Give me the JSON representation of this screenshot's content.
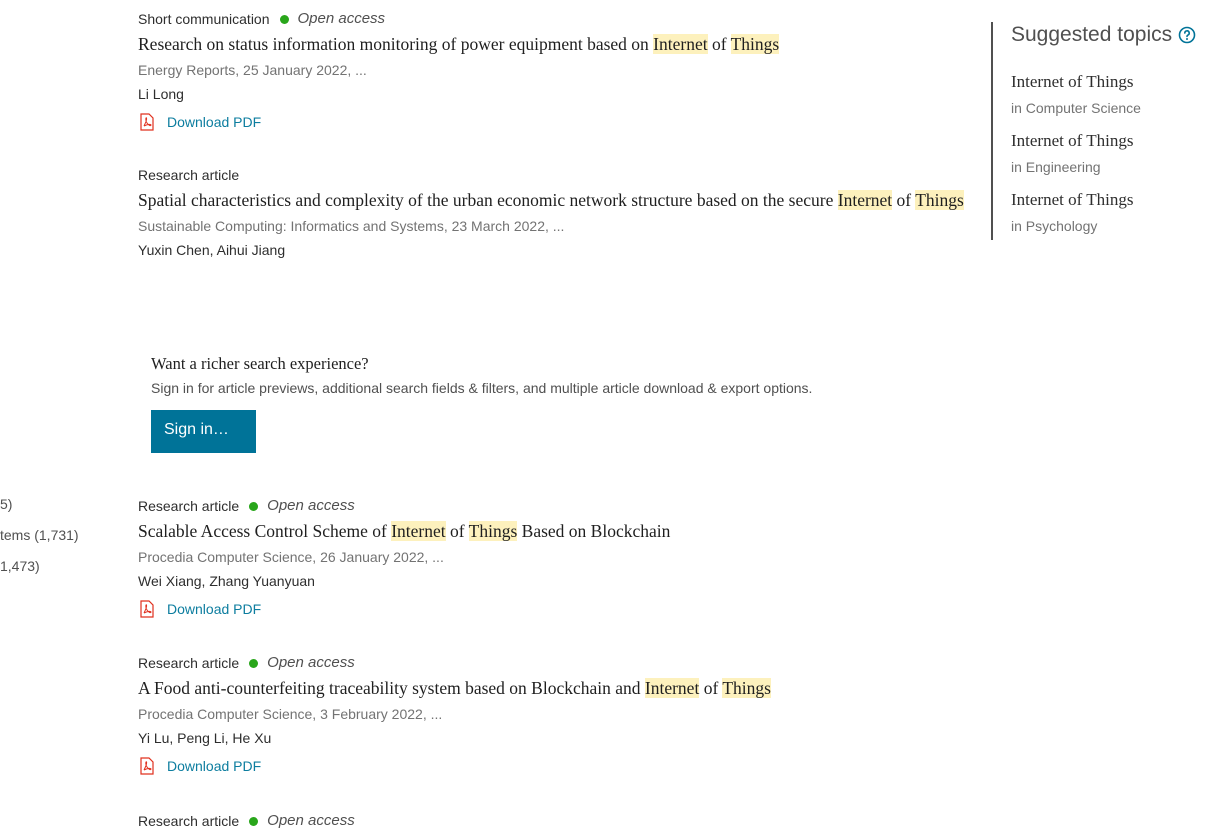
{
  "facets": [
    "5)",
    "tems (1,731)",
    "1,473)"
  ],
  "results": [
    {
      "type": "Short communication",
      "open_access": "Open access",
      "title_parts": [
        {
          "t": "Research on status information monitoring of power equipment based on "
        },
        {
          "t": "Internet",
          "hl": true
        },
        {
          "t": " of "
        },
        {
          "t": "Things",
          "hl": true
        }
      ],
      "source": "Energy Reports, 25 January 2022, ...",
      "authors": "Li Long",
      "pdf": "Download PDF"
    },
    {
      "type": "Research article",
      "open_access": null,
      "title_parts": [
        {
          "t": "Spatial characteristics and complexity of the urban economic network structure based on the secure "
        },
        {
          "t": "Internet",
          "hl": true
        },
        {
          "t": " of "
        },
        {
          "t": "Things",
          "hl": true
        }
      ],
      "source": "Sustainable Computing: Informatics and Systems, 23 March 2022, ...",
      "authors": "Yuxin Chen, Aihui Jiang",
      "pdf": null
    },
    {
      "type": "Research article",
      "open_access": "Open access",
      "title_parts": [
        {
          "t": "Scalable Access Control Scheme of "
        },
        {
          "t": "Internet",
          "hl": true
        },
        {
          "t": " of "
        },
        {
          "t": "Things",
          "hl": true
        },
        {
          "t": " Based on Blockchain"
        }
      ],
      "source": "Procedia Computer Science, 26 January 2022, ...",
      "authors": "Wei Xiang, Zhang Yuanyuan",
      "pdf": "Download PDF"
    },
    {
      "type": "Research article",
      "open_access": "Open access",
      "title_parts": [
        {
          "t": "A Food anti-counterfeiting traceability system based on Blockchain and "
        },
        {
          "t": "Internet",
          "hl": true
        },
        {
          "t": " of "
        },
        {
          "t": "Things",
          "hl": true
        }
      ],
      "source": "Procedia Computer Science, 3 February 2022, ...",
      "authors": "Yi Lu, Peng Li, He Xu",
      "pdf": "Download PDF"
    },
    {
      "type": "Research article",
      "open_access": "Open access",
      "title_parts": [],
      "source": "",
      "authors": "",
      "pdf": null
    }
  ],
  "promo": {
    "title": "Want a richer search experience?",
    "text": "Sign in for article previews, additional search fields & filters, and multiple article download & export options.",
    "button": "Sign in…"
  },
  "suggested_topics": {
    "title": "Suggested topics",
    "help_icon": "question-circle-icon",
    "items": [
      {
        "name": "Internet of Things",
        "sub": "in Computer Science"
      },
      {
        "name": "Internet of Things",
        "sub": "in Engineering"
      },
      {
        "name": "Internet of Things",
        "sub": "in Psychology"
      }
    ]
  },
  "colors": {
    "accent": "#007398",
    "link": "#0c7d9f",
    "open_access": "#29a61b",
    "highlight": "#fdf1bd"
  }
}
